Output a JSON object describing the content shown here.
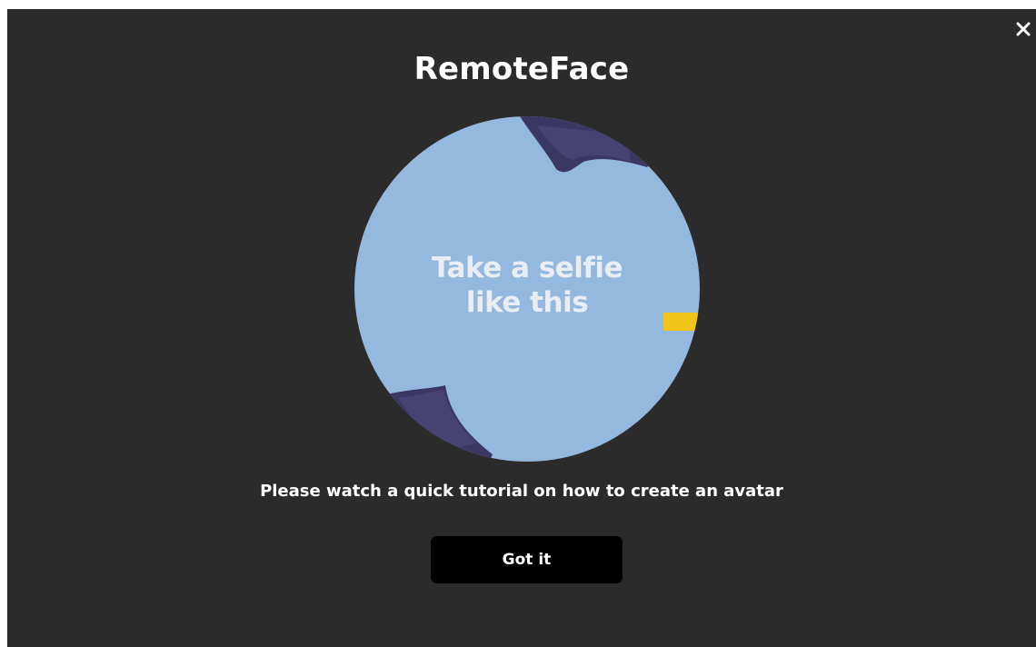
{
  "app": {
    "title": "RemoteFace"
  },
  "video": {
    "caption_line1": "Take a selfie",
    "caption_line2": "like this",
    "background_color": "#95b8df",
    "accent_color": "#f0c419",
    "shape_color": "#3b3763"
  },
  "dialog": {
    "message": "Please watch a quick tutorial on how to create an avatar",
    "confirm_label": "Got it",
    "close_icon": "close-icon",
    "background_color": "#2b2b2b"
  }
}
